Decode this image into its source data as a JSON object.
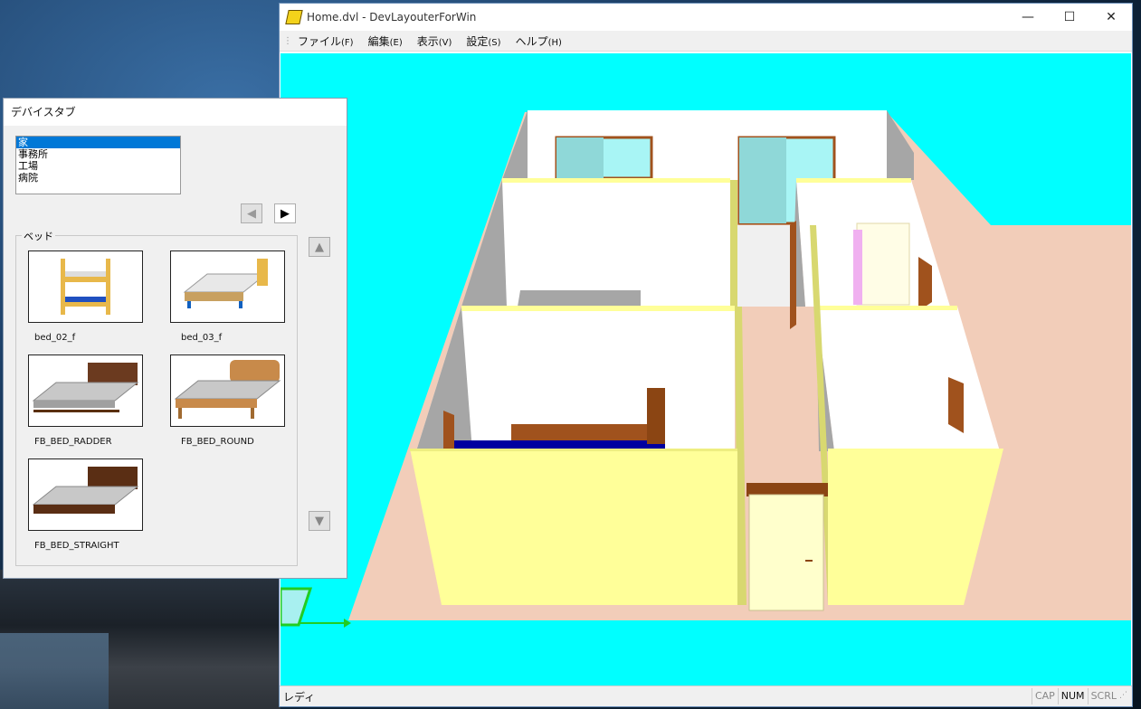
{
  "window": {
    "title": "Home.dvl - DevLayouterForWin",
    "minimize_glyph": "—",
    "maximize_glyph": "☐",
    "close_glyph": "✕"
  },
  "menu": {
    "items": [
      {
        "label": "ファイル",
        "key": "(F)"
      },
      {
        "label": "編集",
        "key": "(E)"
      },
      {
        "label": "表示",
        "key": "(V)"
      },
      {
        "label": "設定",
        "key": "(S)"
      },
      {
        "label": "ヘルプ",
        "key": "(H)"
      }
    ]
  },
  "status": {
    "text": "レディ",
    "cap": "CAP",
    "num": "NUM",
    "scrl": "SCRL"
  },
  "device_tab": {
    "title": "デバイスタブ",
    "categories": [
      "家",
      "事務所",
      "工場",
      "病院"
    ],
    "selected_category": "家",
    "group_label": "ベッド",
    "items": [
      {
        "name": "bed_02_f"
      },
      {
        "name": "bed_03_f"
      },
      {
        "name": "FB_BED_RADDER"
      },
      {
        "name": "FB_BED_ROUND"
      },
      {
        "name": "FB_BED_STRAIGHT"
      }
    ]
  },
  "colors": {
    "viewport_bg": "#00ffff",
    "floor": "#f2cdb9",
    "wall_yellow": "#ffff99",
    "wall_white": "#ffffff",
    "wall_gray": "#a6a6a6",
    "wood": "#a0521d",
    "selection": "#0078d7"
  },
  "icons": [
    "app-icon",
    "prev-arrow-icon",
    "next-arrow-icon",
    "scroll-up-icon",
    "scroll-down-icon"
  ]
}
